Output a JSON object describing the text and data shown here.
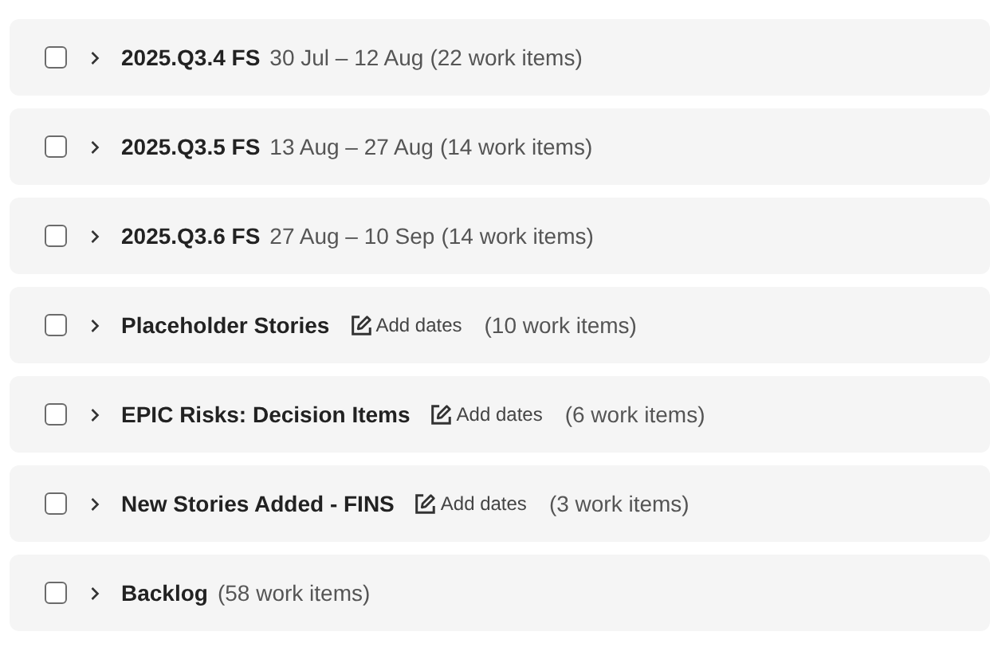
{
  "sprints": [
    {
      "kind": "dated",
      "name": "2025.Q3.4 FS",
      "dates": "30 Jul – 12 Aug",
      "count": "(22 work items)",
      "checked": false,
      "expanded": false
    },
    {
      "kind": "dated",
      "name": "2025.Q3.5 FS",
      "dates": "13 Aug – 27 Aug",
      "count": "(14 work items)",
      "checked": false,
      "expanded": false
    },
    {
      "kind": "dated",
      "name": "2025.Q3.6 FS",
      "dates": "27 Aug – 10 Sep",
      "count": "(14 work items)",
      "checked": false,
      "expanded": false
    },
    {
      "kind": "undated",
      "name": "Placeholder Stories",
      "add_dates": "Add dates",
      "count": "(10 work items)",
      "checked": false,
      "expanded": false
    },
    {
      "kind": "undated",
      "name": "EPIC Risks: Decision Items",
      "add_dates": "Add dates",
      "count": "(6 work items)",
      "checked": false,
      "expanded": false
    },
    {
      "kind": "undated",
      "name": "New Stories Added - FINS",
      "add_dates": "Add dates",
      "count": "(3 work items)",
      "checked": false,
      "expanded": false
    },
    {
      "kind": "backlog",
      "name": "Backlog",
      "count": "(58 work items)",
      "checked": false,
      "expanded": false
    }
  ]
}
